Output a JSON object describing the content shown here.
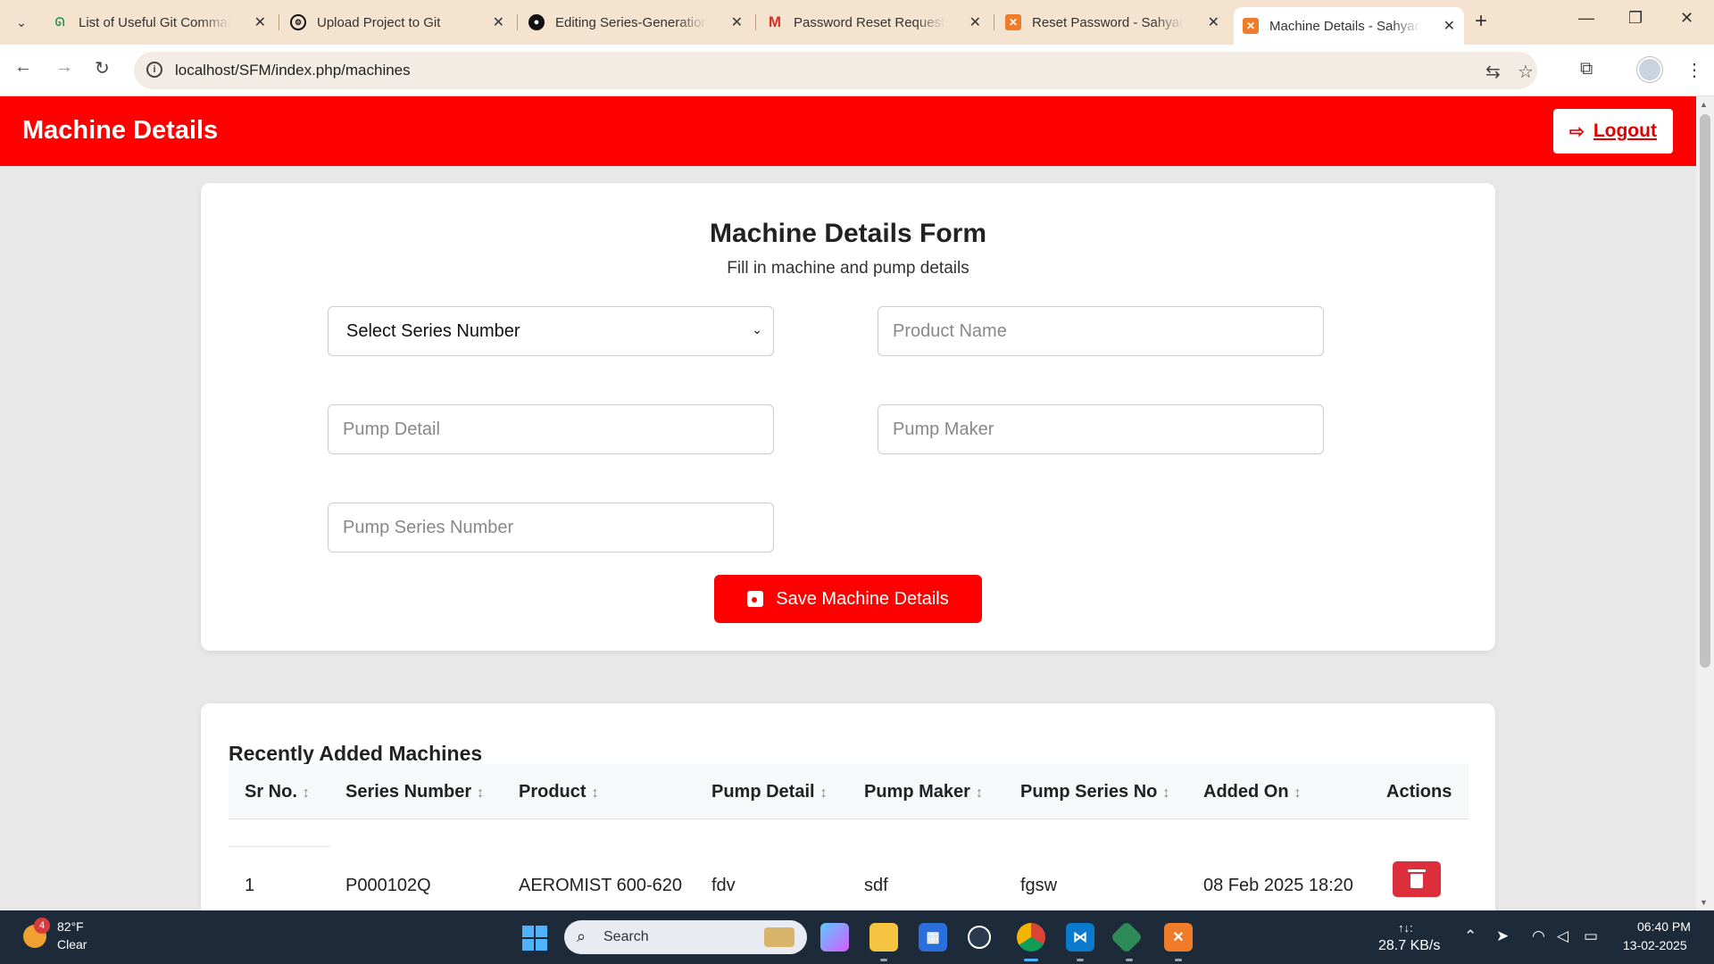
{
  "browser": {
    "tabs": [
      {
        "label": "List of Useful Git Commands",
        "favicon": "geeksforgeeks-icon"
      },
      {
        "label": "Upload Project to Git",
        "favicon": "openai-icon"
      },
      {
        "label": "Editing Series-Generation-",
        "favicon": "github-icon"
      },
      {
        "label": "Password Reset Request - ",
        "favicon": "gmail-icon"
      },
      {
        "label": "Reset Password - Sahyadri",
        "favicon": "xampp-icon"
      },
      {
        "label": "Machine Details - Sahyadri",
        "favicon": "xampp-icon"
      }
    ],
    "new_tab": "+",
    "url": "localhost/SFM/index.php/machines"
  },
  "header": {
    "title": "Machine Details",
    "logout_label": "Logout"
  },
  "form": {
    "title": "Machine Details Form",
    "subtitle": "Fill in machine and pump details",
    "series_select": "Select Series Number",
    "product_name_placeholder": "Product Name",
    "pump_detail_placeholder": "Pump Detail",
    "pump_maker_placeholder": "Pump Maker",
    "pump_series_placeholder": "Pump Series Number",
    "save_label": "Save Machine Details"
  },
  "table": {
    "title": "Recently Added Machines",
    "columns": [
      "Sr No.",
      "Series Number",
      "Product",
      "Pump Detail",
      "Pump Maker",
      "Pump Series No",
      "Added On",
      "Actions"
    ],
    "rows": [
      [
        "1",
        "P000102Q",
        "AEROMIST 600-620",
        "fdv",
        "sdf",
        "fgsw",
        "08 Feb 2025 18:20"
      ]
    ]
  },
  "taskbar": {
    "weather_badge": "4",
    "weather_temp": "82°F",
    "weather_desc": "Clear",
    "search_label": "Search",
    "net_arrows": "↑↓:",
    "net_speed": "28.7 KB/s",
    "time": "06:40 PM",
    "date": "13-02-2025"
  },
  "colors": {
    "brand_red": "#ff0000",
    "delete_red": "#dc2f3b",
    "tabbar": "#f3e3cf",
    "taskbar": "#1d2a3a"
  }
}
